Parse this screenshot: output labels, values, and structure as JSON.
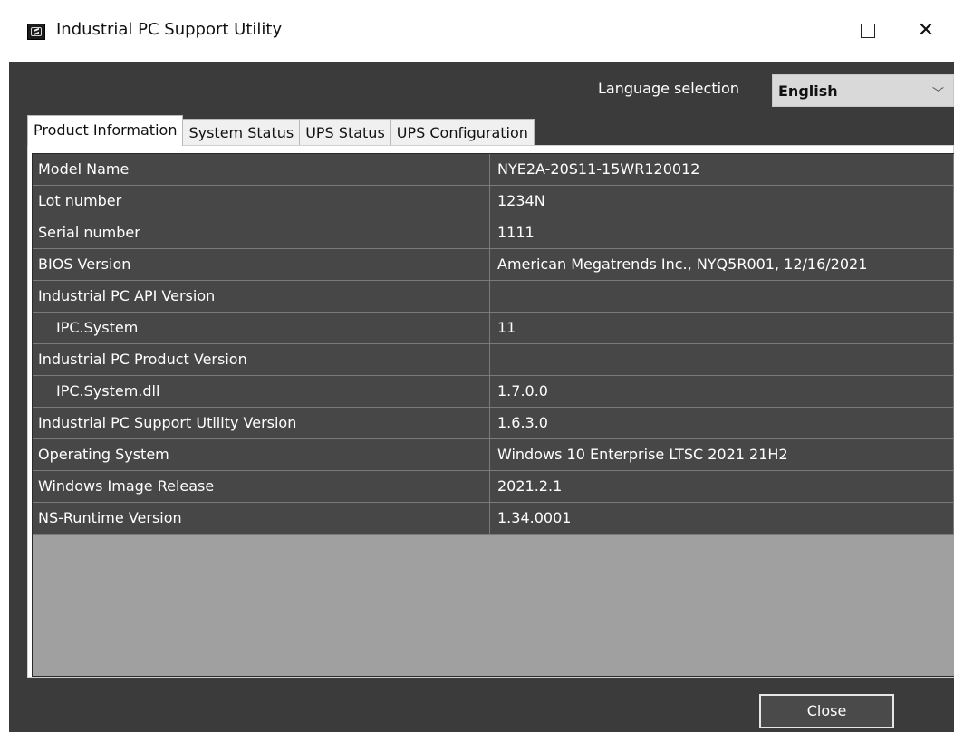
{
  "window": {
    "title": "Industrial PC Support Utility",
    "close_symbol": "✕"
  },
  "language": {
    "label": "Language selection",
    "selected": "English"
  },
  "tabs": [
    {
      "label": "Product Information",
      "active": true
    },
    {
      "label": "System Status",
      "active": false
    },
    {
      "label": "UPS Status",
      "active": false
    },
    {
      "label": "UPS Configuration",
      "active": false
    }
  ],
  "table": {
    "rows": [
      {
        "name": "Model Name",
        "value": "NYE2A-20S11-15WR120012",
        "indent": false
      },
      {
        "name": "Lot number",
        "value": "1234N",
        "indent": false
      },
      {
        "name": "Serial number",
        "value": "1111",
        "indent": false
      },
      {
        "name": "BIOS Version",
        "value": "American Megatrends Inc., NYQ5R001, 12/16/2021",
        "indent": false
      },
      {
        "name": "Industrial PC API Version",
        "value": "",
        "indent": false
      },
      {
        "name": "IPC.System",
        "value": "11",
        "indent": true
      },
      {
        "name": "Industrial PC Product Version",
        "value": "",
        "indent": false
      },
      {
        "name": "IPC.System.dll",
        "value": "1.7.0.0",
        "indent": true
      },
      {
        "name": "Industrial PC Support Utility Version",
        "value": "1.6.3.0",
        "indent": false
      },
      {
        "name": "Operating System",
        "value": "Windows 10 Enterprise LTSC 2021 21H2",
        "indent": false
      },
      {
        "name": "Windows Image Release",
        "value": "2021.2.1",
        "indent": false
      },
      {
        "name": "NS-Runtime Version",
        "value": "1.34.0001",
        "indent": false
      }
    ]
  },
  "footer": {
    "close_label": "Close"
  },
  "icons": {
    "app": "app-icon",
    "minimize": "minimize-icon",
    "maximize": "maximize-icon",
    "close": "close-icon",
    "dropdown": "chevron-down-icon"
  },
  "colors": {
    "client_bg": "#3b3b3b",
    "row_bg": "#474747",
    "empty_grid_bg": "#a0a0a0",
    "tab_bg": "#f0f0f0"
  }
}
